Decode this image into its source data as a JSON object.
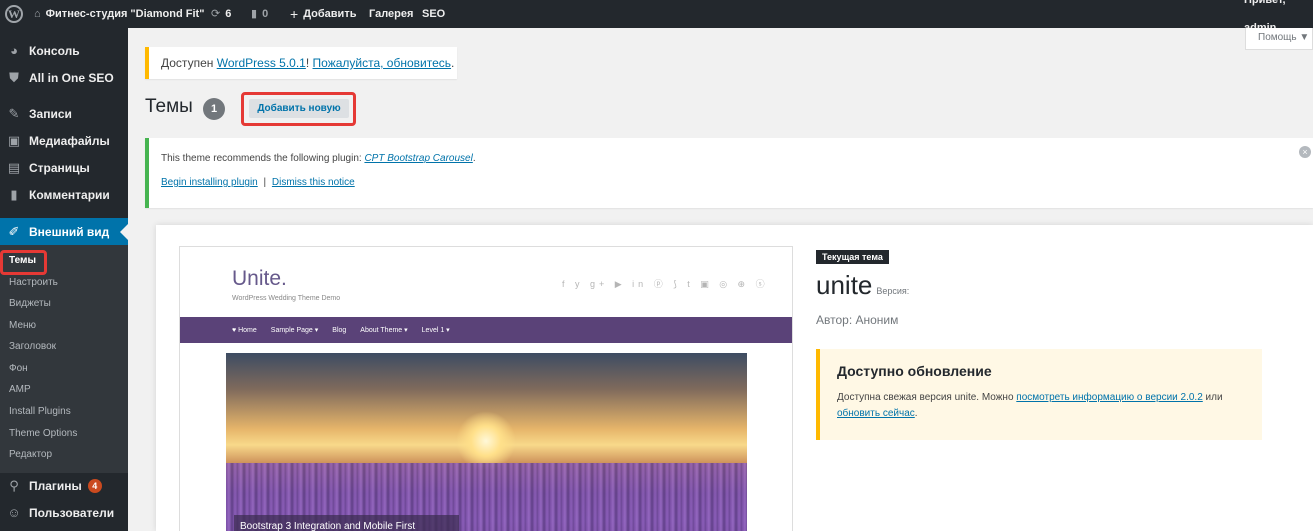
{
  "admin_bar": {
    "site_name": "Фитнес-студия \"Diamond Fit\"",
    "updates_count": "6",
    "comments_count": "0",
    "add_label": "Добавить",
    "gallery_label": "Галерея",
    "seo_label": "SEO",
    "greeting": "Привет, admin"
  },
  "sidebar": {
    "items": [
      {
        "label": "Консоль",
        "icon": "dashboard-icon"
      },
      {
        "label": "All in One SEO",
        "icon": "shield-icon"
      },
      {
        "label": "Записи",
        "icon": "pin-icon"
      },
      {
        "label": "Медиафайлы",
        "icon": "media-icon"
      },
      {
        "label": "Страницы",
        "icon": "page-icon"
      },
      {
        "label": "Комментарии",
        "icon": "comment-icon"
      },
      {
        "label": "Внешний вид",
        "icon": "brush-icon"
      },
      {
        "label": "Плагины",
        "icon": "plugin-icon",
        "badge": "4"
      },
      {
        "label": "Пользователи",
        "icon": "users-icon"
      }
    ],
    "submenu": [
      "Темы",
      "Настроить",
      "Виджеты",
      "Меню",
      "Заголовок",
      "Фон",
      "AMP",
      "Install Plugins",
      "Theme Options",
      "Редактор"
    ]
  },
  "screen_options": "Помощь ▼",
  "update_notice": {
    "prefix": "Доступен ",
    "link1": "WordPress 5.0.1",
    "sep": "! ",
    "link2": "Пожалуйста, обновитесь",
    "suffix": "."
  },
  "page": {
    "title": "Темы",
    "count": "1",
    "add_new": "Добавить новую"
  },
  "plugin_notice": {
    "text": "This theme recommends the following plugin: ",
    "plugin": "CPT Bootstrap Carousel",
    "begin": "Begin installing plugin",
    "divider": "|",
    "dismiss": "Dismiss this notice"
  },
  "theme_preview": {
    "logo": "Unite.",
    "tagline": "WordPress Wedding Theme Demo",
    "social": "f y g+ ▶ in ⓟ ⟆ t ▣ ◎ ⊕ ⓢ",
    "nav": [
      "♥ Home",
      "Sample Page ▾",
      "Blog",
      "About Theme ▾",
      "Level 1 ▾"
    ],
    "caption": "Bootstrap 3 Integration and Mobile First"
  },
  "theme_info": {
    "current_label": "Текущая тема",
    "name": "unite",
    "version_label": "Версия:",
    "author": "Автор: Аноним",
    "update_title": "Доступно обновление",
    "update_text_prefix": "Доступна свежая версия unite. Можно ",
    "update_link1": "посмотреть информацию о версии 2.0.2",
    "update_mid": " или ",
    "update_link2": "обновить сейчас",
    "update_suffix": "."
  }
}
